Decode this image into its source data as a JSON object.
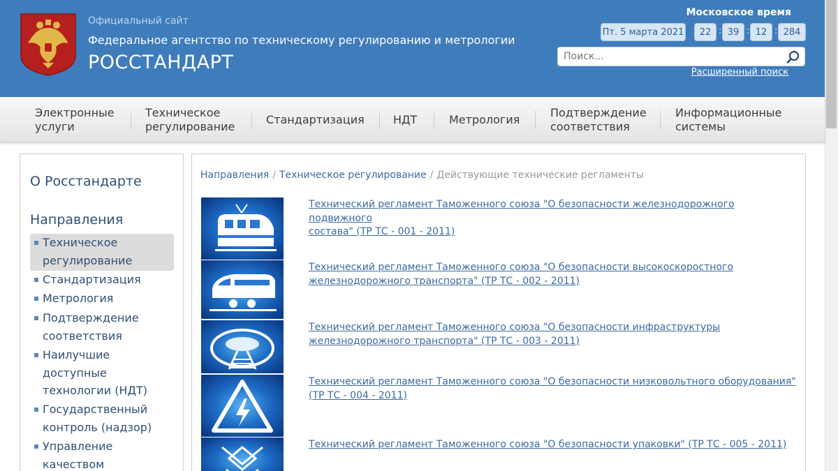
{
  "header": {
    "site_label": "Официальный сайт",
    "agency": "Федеральное агентство по техническому регулированию и метрологии",
    "brand": "РОССТАНДАРТ",
    "time_label": "Московское время",
    "date": "Пт. 5 марта 2021",
    "time": {
      "h": "22",
      "m": "39",
      "s": "12",
      "ms": "284"
    },
    "search_placeholder": "Поиск...",
    "advanced_search": "Расширенный поиск"
  },
  "nav": {
    "items": [
      {
        "line1": "Электронные",
        "line2": "услуги"
      },
      {
        "line1": "Техническое",
        "line2": "регулирование"
      },
      {
        "line1": "Стандартизация",
        "line2": ""
      },
      {
        "line1": "НДТ",
        "line2": ""
      },
      {
        "line1": "Метрология",
        "line2": ""
      },
      {
        "line1": "Подтверждение",
        "line2": "соответствия"
      },
      {
        "line1": "Информационные",
        "line2": "системы"
      }
    ]
  },
  "sidebar": {
    "about": "О Росстандарте",
    "directions": "Направления",
    "items": [
      {
        "line1": "Техническое",
        "line2": "регулирование",
        "line3": ""
      },
      {
        "line1": "Стандартизация",
        "line2": "",
        "line3": ""
      },
      {
        "line1": "Метрология",
        "line2": "",
        "line3": ""
      },
      {
        "line1": "Подтверждение",
        "line2": "соответствия",
        "line3": ""
      },
      {
        "line1": "Наилучшие",
        "line2": "доступные",
        "line3": "технологии (НДТ)"
      },
      {
        "line1": "Государственный",
        "line2": "контроль (надзор)",
        "line3": ""
      },
      {
        "line1": "Управление",
        "line2": "качеством",
        "line3": ""
      }
    ]
  },
  "breadcrumb": {
    "items": [
      "Направления",
      "Техническое регулирование",
      "Действующие технические регламенты"
    ]
  },
  "regulations": [
    {
      "line1": "Технический регламент Таможенного союза \"О безопасности железнодорожного подвижного",
      "line2": "состава\" (ТР ТС - 001 - 2011)",
      "icon": "train-icon"
    },
    {
      "line1": "Технический регламент Таможенного союза \"О безопасности высокоскоростного",
      "line2": "железнодорожного транспорта\" (ТР ТС - 002 - 2011)",
      "icon": "high-speed-train-icon"
    },
    {
      "line1": "Технический регламент Таможенного союза \"О безопасности инфраструктуры",
      "line2": "железнодорожного транспорта\" (ТР ТС - 003 - 2011)",
      "icon": "railway-tunnel-icon"
    },
    {
      "line1": "Технический регламент Таможенного союза \"О безопасности низковольтного оборудования\"",
      "line2": "(ТР ТС - 004 - 2011)",
      "icon": "high-voltage-icon"
    },
    {
      "line1": "Технический регламент Таможенного союза \"О безопасности упаковки\" (ТР ТС - 005 - 2011)",
      "line2": "",
      "icon": "package-icon"
    }
  ],
  "colors": {
    "header_bg": "#3f7cbb",
    "link": "#3b6aa0",
    "accent": "#2f4f74"
  }
}
